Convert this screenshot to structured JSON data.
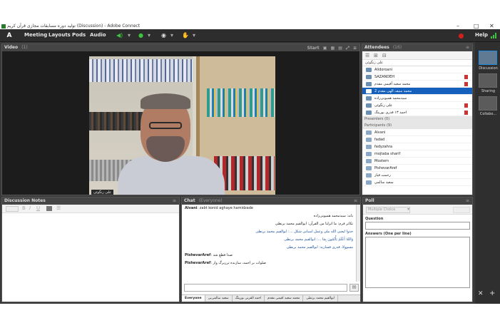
{
  "window": {
    "title": "تولید دوره مسابقات مجازی قرآن کریم (Discussion) - Adobe Connect",
    "minimize": "–",
    "maximize": "□",
    "close": "✕"
  },
  "menubar": {
    "logo": "Adobe",
    "items": [
      "Meeting",
      "Layouts",
      "Pods",
      "Audio"
    ],
    "help": "Help"
  },
  "video": {
    "title": "Video",
    "count": "(1)",
    "start_label": "Start",
    "name_label": "علی زنگوئی"
  },
  "attendees": {
    "title": "Attendees",
    "count": "(16)",
    "search_label": "علی زنگوئی",
    "hosts": [
      "Alidoroani",
      "SAZANDEH",
      "محمد سعید آقیمی مقدم",
      "محمد منیف الهی مقدم 2",
      "سیدمحمد همیونی‌زاده",
      "علی زنگوئی",
      "احمد ۱۳ قدری بورینگ"
    ],
    "selected_index": 3,
    "presenters_label": "Presenters (0)",
    "participants_label": "Participants (9)",
    "participants": [
      "Alvani",
      "fadad",
      "fadyzahra",
      "mojtaba sharif",
      "Mostern",
      "PishevarAref",
      "رحمت قیاز",
      "سعید سالمی"
    ]
  },
  "discussion_notes": {
    "title": "Discussion Notes"
  },
  "chat": {
    "title": "Chat",
    "scope": "(Everyone)",
    "messages": [
      {
        "sender": "Alvani",
        "text": "zabt konid aghaye hamidzade"
      },
      {
        "sender": "",
        "text": "باند: سیدمحمد همیونی‌زاده"
      },
      {
        "sender": "",
        "text": "تکاثر فرم: ما انزلنا من القرآن: ابوالقیم محمد برنطی"
      },
      {
        "sender": "",
        "text": "خذوا لیعنی الله ملی وعمل اسبابی شکل ...: ابوالقیم محمد برنطی"
      },
      {
        "sender": "",
        "text": "وَاللهُ أَعْلَمُ يَأْتُمُونَ بِمَا ...: ابوالقیم محمد برنطی"
      },
      {
        "sender": "",
        "text": "مسوولا، قدری فسازید: ابوالقیم محمد برنطی"
      },
      {
        "sender": "PishevarAref",
        "text": "صدا قطع شد"
      },
      {
        "sender": "PishevarAref",
        "text": "صلوات بر احمد، سازنده ترزبرگ وار"
      }
    ],
    "tabs": [
      "Everyone",
      "سعید سالمی‌بی",
      "احمد القرنی بورینگ",
      "محمد سعید اقیمی مقدم",
      "ابوالقیم محمد برنطی"
    ]
  },
  "poll": {
    "title": "Poll",
    "type_value": "Multiple Choice",
    "question_label": "Question",
    "answers_label": "Answers (One per line)"
  },
  "layouts": {
    "items": [
      "Discussion",
      "Sharing",
      "Collabo..."
    ]
  },
  "colors": {
    "accent": "#1560bd",
    "menubar": "#2d2d2d",
    "pod_header": "#454545",
    "record": "#d51f1f"
  }
}
